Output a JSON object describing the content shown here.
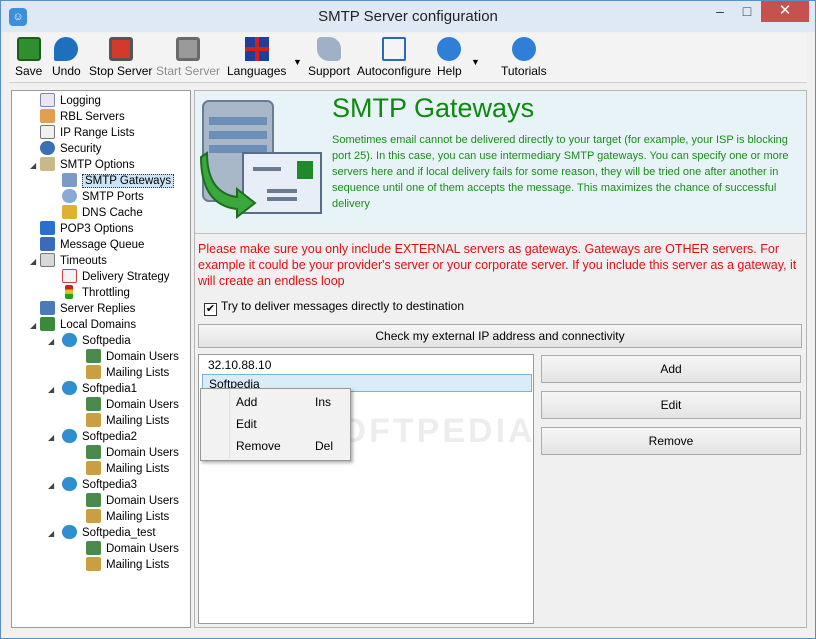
{
  "window": {
    "title": "SMTP Server configuration",
    "min": "–",
    "max": "□",
    "close": "✕",
    "app_icon_glyph": "☺"
  },
  "toolbar": {
    "save": "Save",
    "undo": "Undo",
    "stop_server": "Stop Server",
    "start_server": "Start Server",
    "languages": "Languages",
    "support": "Support",
    "autoconfigure": "Autoconfigure",
    "help": "Help",
    "tutorials": "Tutorials",
    "dropdown_arrow": "▼"
  },
  "tree": {
    "logging": "Logging",
    "rbl_servers": "RBL Servers",
    "ip_range_lists": "IP Range Lists",
    "security": "Security",
    "smtp_options": "SMTP Options",
    "smtp_gateways": "SMTP Gateways",
    "smtp_ports": "SMTP Ports",
    "dns_cache": "DNS Cache",
    "pop3_options": "POP3 Options",
    "message_queue": "Message Queue",
    "timeouts": "Timeouts",
    "delivery_strategy": "Delivery Strategy",
    "throttling": "Throttling",
    "server_replies": "Server Replies",
    "local_domains": "Local Domains",
    "domains": [
      {
        "name": "Softpedia",
        "users": "Domain Users",
        "lists": "Mailing Lists"
      },
      {
        "name": "Softpedia1",
        "users": "Domain Users",
        "lists": "Mailing Lists"
      },
      {
        "name": "Softpedia2",
        "users": "Domain Users",
        "lists": "Mailing Lists"
      },
      {
        "name": "Softpedia3",
        "users": "Domain Users",
        "lists": "Mailing Lists"
      },
      {
        "name": "Softpedia_test",
        "users": "Domain Users",
        "lists": "Mailing Lists"
      }
    ],
    "expander": "◢"
  },
  "main": {
    "title": "SMTP Gateways",
    "description": "Sometimes email cannot be delivered directly to your target (for example, your ISP is blocking port 25). In this case, you can use intermediary SMTP gateways. You can specify one or more servers here and if local delivery fails for some reason, they will be tried one after another in sequence until one of them accepts the message. This maximizes the chance of successful delivery",
    "warning": "Please make sure you only include EXTERNAL servers as gateways. Gateways are OTHER servers. For example it could be your provider's server or your corporate server. If you include this server as a gateway, it will create an endless loop",
    "checkbox_label": "Try to deliver messages directly to destination",
    "checkbox_mark": "✔",
    "check_ip_button": "Check my external IP address and connectivity",
    "gateways": [
      "32.10.88.10",
      "Softpedia"
    ],
    "add_button": "Add",
    "edit_button": "Edit",
    "remove_button": "Remove",
    "watermark": "SOFTPEDIA"
  },
  "context_menu": {
    "add": "Add",
    "add_key": "Ins",
    "edit": "Edit",
    "remove": "Remove",
    "remove_key": "Del"
  },
  "colors": {
    "title_green": "#0d8a0d",
    "warning_red": "#e01010",
    "close_red": "#c75050"
  }
}
